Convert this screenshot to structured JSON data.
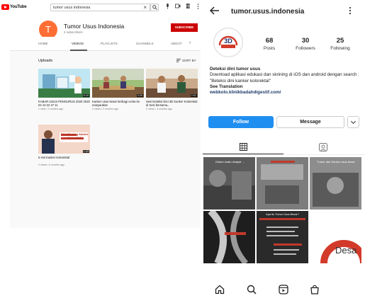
{
  "youtube": {
    "logo_text": "YouTube",
    "search": {
      "value": "tumor usus indonesia"
    },
    "channel": {
      "avatar_letter": "T",
      "name": "Tumor Usus Indonesia",
      "subscribers": "2 subscribers",
      "subscribe_label": "SUBSCRIBE"
    },
    "tabs": [
      {
        "label": "HOME"
      },
      {
        "label": "VIDEOS",
        "active": true
      },
      {
        "label": "PLAYLISTS"
      },
      {
        "label": "CHANNELS"
      },
      {
        "label": "ABOUT"
      }
    ],
    "uploads_label": "Uploads",
    "sort_label": "SORT BY",
    "videos": [
      {
        "title": "KABAR USUS PENGURUS 2020 2020 04 13 22 27 11",
        "meta": "1 view • 2 months ago",
        "duration": "6:18"
      },
      {
        "title": "Kanker usus besar berbagi cerita ke masyarakat",
        "meta": "2 views • 2 months ago",
        "duration": "3:26"
      },
      {
        "title": "Sesi Deteksi Dini 3D Kanker Kolorektal di Sesi bersama...",
        "meta": "3 views • 4 months ago",
        "duration": "2:01"
      },
      {
        "title": "5 Hal Kanker Kolorektal",
        "meta": "2 views • 5 months ago",
        "duration": "1:43",
        "thumb_text": "5 Hal Tentang Kanker Kolorektal"
      }
    ]
  },
  "instagram": {
    "handle": "tumor.usus.indonesia",
    "avatar_text": "3D",
    "stats": [
      {
        "value": "68",
        "label": "Posts"
      },
      {
        "value": "30",
        "label": "Followers"
      },
      {
        "value": "25",
        "label": "Following"
      }
    ],
    "bio": {
      "name": "Deteksi dini tumor usus",
      "line1": "Download aplikasi edukasi dan skrining di iOS dan android dengan search :",
      "line2": "\"Beteksi dini kanker kolorektal\"",
      "translation": "See Translation",
      "link": "webkolo.klinikbadahdigestif.com/"
    },
    "follow_label": "Follow",
    "message_label": "Message",
    "tile_texts": {
      "t1": "Dalam suatu riwayat ...",
      "t3": "Tumor dan Kanker usus besar",
      "t5": "Apa Itu Tumor Usus Besar?",
      "t6": "Desa"
    },
    "nav": [
      "home-icon",
      "search-icon",
      "reels-icon",
      "shop-icon"
    ]
  }
}
